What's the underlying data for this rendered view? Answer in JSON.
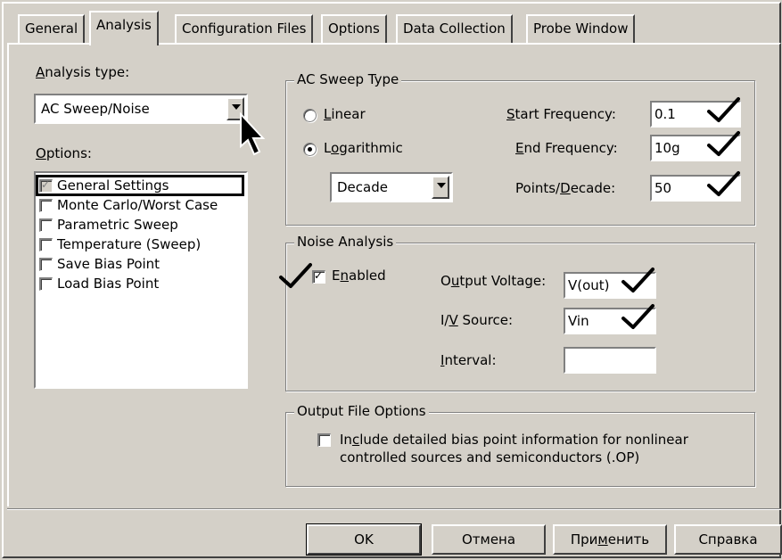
{
  "tabs": [
    {
      "label": "General",
      "active": false
    },
    {
      "label": "Analysis",
      "active": true
    },
    {
      "label": "Configuration Files",
      "active": false
    },
    {
      "label": "Options",
      "active": false
    },
    {
      "label": "Data Collection",
      "active": false
    },
    {
      "label": "Probe Window",
      "active": false
    }
  ],
  "analysis_type": {
    "label_u": "A",
    "label_rest": "nalysis type:",
    "value": "AC Sweep/Noise"
  },
  "options": {
    "label_u": "O",
    "label_rest": "ptions:",
    "items": [
      {
        "label": "General Settings",
        "checked": true,
        "selected": true
      },
      {
        "label": "Monte Carlo/Worst Case",
        "checked": false
      },
      {
        "label": "Parametric Sweep",
        "checked": false
      },
      {
        "label": "Temperature (Sweep)",
        "checked": false
      },
      {
        "label": "Save Bias Point",
        "checked": false
      },
      {
        "label": "Load Bias Point",
        "checked": false
      }
    ]
  },
  "ac_sweep": {
    "title": "AC Sweep Type",
    "linear_u": "L",
    "linear_rest": "inear",
    "log_pre": "L",
    "log_u": "o",
    "log_rest": "garithmic",
    "selected": "Logarithmic",
    "decade_value": "Decade",
    "start_u": "S",
    "start_rest": "tart Frequency:",
    "start_value": "0.1",
    "end_u": "E",
    "end_rest": "nd Frequency:",
    "end_value": "10g",
    "points_pre": "Points/",
    "points_u": "D",
    "points_rest": "ecade:",
    "points_value": "50"
  },
  "noise": {
    "title": "Noise Analysis",
    "enabled_pre": "E",
    "enabled_u": "n",
    "enabled_rest": "abled",
    "enabled": true,
    "output_pre": "O",
    "output_u": "u",
    "output_rest": "tput Voltage:",
    "output_value": "V(out)",
    "iv_pre": "I/",
    "iv_u": "V",
    "iv_rest": " Source:",
    "iv_value": "Vin",
    "interval_u": "I",
    "interval_rest": "nterval:",
    "interval_value": ""
  },
  "output_file": {
    "title": "Output File Options",
    "line1_pre": "In",
    "line1_u": "c",
    "line1_rest": "lude detailed bias point information for nonlinear",
    "line2": "controlled sources and semiconductors (.OP)",
    "checked": false
  },
  "buttons": {
    "ok": "OK",
    "cancel": "Отмена",
    "apply_pre": "При",
    "apply_u": "м",
    "apply_rest": "енить",
    "help": "Справка"
  },
  "colors": {
    "face": "#d4d0c8",
    "highlight": "#ffffff",
    "shadow": "#808080",
    "dark_shadow": "#404040",
    "annotation": "#000000"
  },
  "annotations": {
    "check_marks": [
      "start-frequency",
      "end-frequency",
      "points-decade",
      "noise-enabled",
      "output-voltage",
      "iv-source"
    ],
    "cursor": "arrow"
  }
}
